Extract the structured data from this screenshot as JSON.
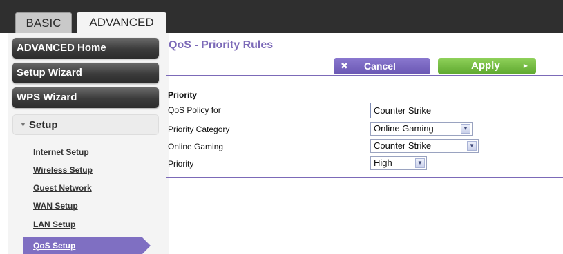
{
  "tabs": {
    "basic": "BASIC",
    "advanced": "ADVANCED"
  },
  "sidebar": {
    "advanced_home": "ADVANCED Home",
    "setup_wizard": "Setup Wizard",
    "wps_wizard": "WPS Wizard",
    "setup": "Setup",
    "links": [
      "Internet Setup",
      "Wireless Setup",
      "Guest Network",
      "WAN Setup",
      "LAN Setup",
      "QoS Setup"
    ]
  },
  "page": {
    "title": "QoS - Priority Rules",
    "cancel_label": "Cancel",
    "apply_label": "Apply",
    "section_heading": "Priority"
  },
  "form": {
    "rows": [
      {
        "label": "QoS Policy for",
        "value": "Counter Strike"
      },
      {
        "label": "Priority Category",
        "value": "Online Gaming"
      },
      {
        "label": "Online Gaming",
        "value": "Counter Strike"
      },
      {
        "label": "Priority",
        "value": "High"
      }
    ]
  },
  "colors": {
    "accent": "#7c6ab8",
    "apply": "#6cb83a",
    "topbar": "#2f2f2f"
  },
  "icons": {
    "cancel": "close-icon",
    "apply": "arrow-right-icon",
    "dropdown": "chevron-down-icon",
    "setup": "triangle-down-icon"
  }
}
